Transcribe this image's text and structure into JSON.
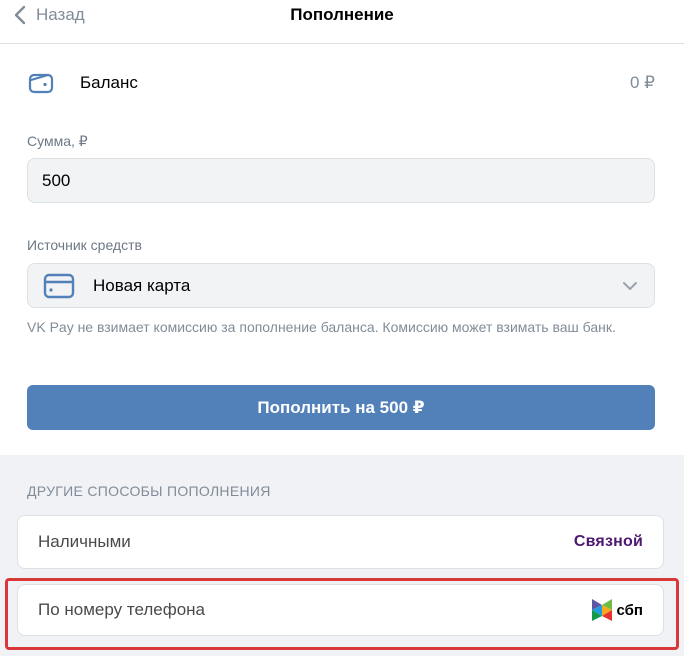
{
  "header": {
    "back_label": "Назад",
    "title": "Пополнение"
  },
  "balance": {
    "label": "Баланс",
    "value": "0 ₽"
  },
  "amount": {
    "label": "Сумма, ₽",
    "value": "500"
  },
  "source": {
    "label": "Источник средств",
    "selected": "Новая карта"
  },
  "hint": "VK Pay не взимает комиссию за пополнение баланса. Комиссию может взимать ваш банк.",
  "submit_label": "Пополнить на 500 ₽",
  "other_methods": {
    "header": "ДРУГИЕ СПОСОБЫ ПОПОЛНЕНИЯ",
    "items": [
      {
        "label": "Наличными",
        "provider": "Связной"
      },
      {
        "label": "По номеру телефона",
        "provider": "сбп"
      }
    ]
  },
  "colors": {
    "accent": "#5181b8",
    "highlight": "#d9383a",
    "svyaznoy": "#4d1870"
  },
  "icons": {
    "back": "chevron-left-icon",
    "balance": "wallet-icon",
    "source": "credit-card-icon",
    "select": "chevron-down-icon",
    "sbp": "sbp-logo-icon"
  }
}
